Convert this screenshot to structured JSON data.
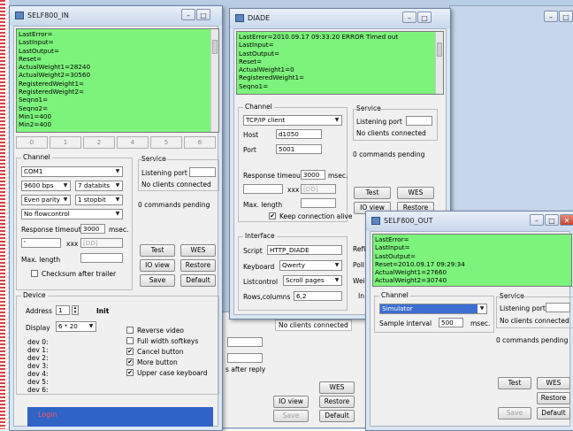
{
  "self800_in": {
    "title": "SELF800_IN",
    "controls": {
      "minimize": "–",
      "maximize": "□",
      "close": "✕"
    },
    "log_lines": [
      "LastError=",
      "LastInput=",
      "LastOutput=",
      "Reset=",
      "ActualWeight1=28240",
      "ActualWeight2=30560",
      "RegisteredWeight1=",
      "RegisteredWeight2=",
      "Seqno1=",
      "Seqno2=",
      "Min1=400",
      "Min2=400"
    ],
    "tabs": [
      "0",
      "1",
      "2",
      "4",
      "5",
      "6"
    ],
    "channel": {
      "title": "Channel",
      "port": "COM1",
      "baud": "9600 bps",
      "databits": "7 databits",
      "parity": "Even parity",
      "stopbit": "1 stopbit",
      "flow": "No flowcontrol",
      "response_timeout_label": "Response timeout",
      "response_timeout": "3000",
      "msec": "msec.",
      "input_a": "'",
      "xxx": "xxx",
      "dd": "[DD]",
      "max_length_label": "Max. length",
      "checksum_label": "Checksum after trailer"
    },
    "service": {
      "title": "Service",
      "listening_port_label": "Listening port",
      "status": "No clients connected",
      "pending": "0 commands pending"
    },
    "buttons": {
      "test": "Test",
      "wes": "WES",
      "io_view": "IO view",
      "restore": "Restore",
      "save": "Save",
      "default": "Default"
    },
    "device": {
      "title": "Device",
      "address_label": "Address",
      "address": "1",
      "init": "Init",
      "display_label": "Display",
      "display": "6 * 20",
      "devs": [
        "dev 0:",
        "dev 1:",
        "dev 2:",
        "dev 3:",
        "dev 4:",
        "dev 5:",
        "dev 6:"
      ],
      "options": [
        {
          "label": "Reverse video",
          "checked": false
        },
        {
          "label": "Full width softkeys",
          "checked": false
        },
        {
          "label": "Cancel button",
          "checked": true
        },
        {
          "label": "More button",
          "checked": true
        },
        {
          "label": "Upper case keyboard",
          "checked": true
        }
      ]
    },
    "login": "Login"
  },
  "diade": {
    "title": "DIADE",
    "log_lines": [
      "LastError=2010.09.17 09:33:20 ERROR Timed out",
      "LastInput=",
      "LastOutput=",
      "Reset=",
      "ActualWeight1=0",
      "RegisteredWeight1=",
      "Seqno1="
    ],
    "channel": {
      "title": "Channel",
      "type": "TCP/IP client",
      "host_label": "Host",
      "host": "d1050",
      "port_label": "Port",
      "port": "5001",
      "response_timeout_label": "Response timeout",
      "response_timeout": "3000",
      "msec": "msec.",
      "xxx": "xxx",
      "dd": "[DD]",
      "max_length_label": "Max. length",
      "keep_alive_label": "Keep connection alive"
    },
    "service": {
      "title": "Service",
      "listening_port_label": "Listening port",
      "status": "No clients connected",
      "pending": "0 commands pending"
    },
    "buttons": {
      "test": "Test",
      "wes": "WES",
      "io_view": "IO view",
      "restore": "Restore"
    },
    "interface": {
      "title": "Interface",
      "script_label": "Script",
      "script": "HTTP_DIADE",
      "keyboard_label": "Keyboard",
      "keyboard": "Qwerty",
      "listcontrol_label": "Listcontrol",
      "listcontrol": "Scroll pages",
      "rows_label": "Rows,columns",
      "rows": "6,2",
      "cut_refi": "Refi",
      "cut_poll": "Poll",
      "cut_wei": "Wei",
      "cut_in": "In"
    },
    "behind": {
      "status": "No clients connected",
      "after_reply": "s after reply",
      "wes": "WES",
      "io_view": "IO view",
      "restore": "Restore",
      "save": "Save",
      "default": "Default"
    }
  },
  "self800_out": {
    "title": "SELF800_OUT",
    "log_lines": [
      "LastError=",
      "LastInput=",
      "LastOutput=",
      "Reset=2010.09.17 09:29:34",
      "ActualWeight1=27660",
      "ActualWeight2=30740"
    ],
    "channel": {
      "title": "Channel",
      "type": "Simulator",
      "sample_interval_label": "Sample interval",
      "sample_interval": "500",
      "msec": "msec."
    },
    "service": {
      "title": "Service",
      "listening_port_label": "Listening port",
      "status": "No clients connected",
      "pending": "0 commands pending"
    },
    "buttons": {
      "test": "Test",
      "wes": "WES",
      "restore": "Restore",
      "save": "Save",
      "default": "Default"
    }
  },
  "colors": {
    "log_green": "#7cf47c",
    "desktop": "#b9cde5",
    "selection": "#3b6fd1",
    "login_bar": "#2f63c6",
    "login_text": "#ff5a5a"
  }
}
